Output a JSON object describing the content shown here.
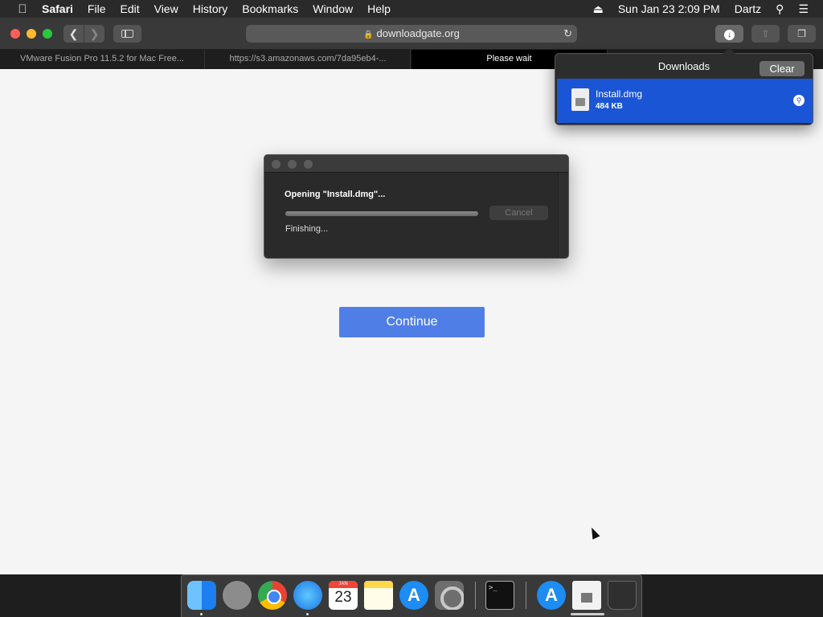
{
  "menubar": {
    "apple_icon": "apple-icon",
    "app": "Safari",
    "items": [
      "File",
      "Edit",
      "View",
      "History",
      "Bookmarks",
      "Window",
      "Help"
    ],
    "datetime": "Sun Jan 23  2:09 PM",
    "user": "Dartz"
  },
  "toolbar": {
    "url": "downloadgate.org"
  },
  "tabs": [
    {
      "label": "VMware Fusion Pro 11.5.2 for Mac Free..."
    },
    {
      "label": "https://s3.amazonaws.com/7da95eb4-..."
    },
    {
      "label": "Please wait"
    }
  ],
  "dialog": {
    "heading": "Opening \"Install.dmg\"...",
    "cancel_label": "Cancel",
    "status": "Finishing..."
  },
  "page": {
    "continue_label": "Continue"
  },
  "downloads": {
    "title": "Downloads",
    "clear_label": "Clear",
    "items": [
      {
        "name": "Install.dmg",
        "size": "484 KB"
      }
    ]
  },
  "dock": {
    "calendar_month": "JAN",
    "calendar_day": "23",
    "terminal_prompt": ">_"
  },
  "colors": {
    "accent": "#4f7fe6",
    "selection": "#1a55d6"
  }
}
